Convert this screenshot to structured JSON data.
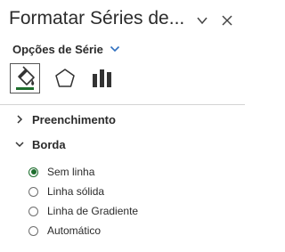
{
  "panel": {
    "title": "Formatar Séries de...",
    "options_dropdown_label": "Opções de Série"
  },
  "icon_tabs": [
    {
      "name": "fill-line",
      "icon": "paint-bucket-icon",
      "selected": true
    },
    {
      "name": "effects",
      "icon": "pentagon-icon",
      "selected": false
    },
    {
      "name": "series-options",
      "icon": "bar-chart-icon",
      "selected": false
    }
  ],
  "sections": {
    "fill": {
      "label": "Preenchimento",
      "expanded": false
    },
    "border": {
      "label": "Borda",
      "expanded": true
    }
  },
  "border_options": [
    {
      "label": "Sem linha",
      "checked": true
    },
    {
      "label": "Linha sólida",
      "checked": false
    },
    {
      "label": "Linha de Gradiente",
      "checked": false
    },
    {
      "label": "Automático",
      "checked": false
    }
  ],
  "colors": {
    "accent": "#1e6e2e",
    "dropdown_chevron": "#2f6fbf",
    "text": "#2b2b2b",
    "divider": "#d4d4d4"
  }
}
